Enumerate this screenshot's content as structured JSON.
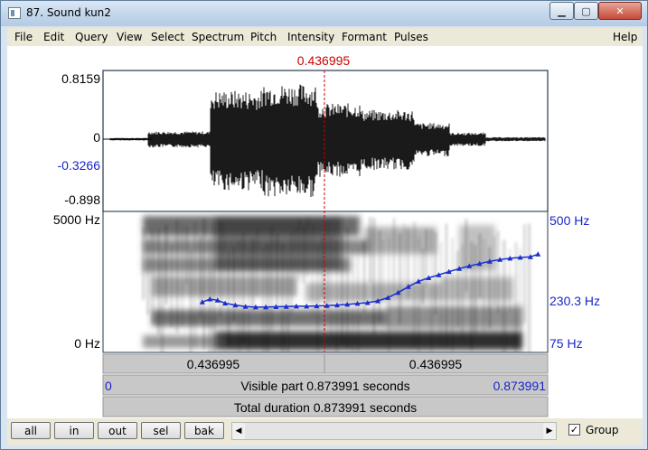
{
  "window": {
    "title": "87. Sound kun2",
    "minimize_label": "▁",
    "maximize_label": "▢",
    "close_label": "✕"
  },
  "menu": [
    "File",
    "Edit",
    "Query",
    "View",
    "Select",
    "Spectrum",
    "Pitch",
    "Intensity",
    "Formant",
    "Pulses",
    "Help"
  ],
  "cursor_time": "0.436995",
  "waveform": {
    "y_max": "0.8159",
    "y_zero": "0",
    "y_cursor_value": "-0.3266",
    "y_min": "-0.898"
  },
  "spectrogram": {
    "freq_max": "5000 Hz",
    "freq_min": "0 Hz",
    "pitch_max": "500 Hz",
    "pitch_at_cursor": "230.3 Hz",
    "pitch_min": "75 Hz"
  },
  "time_bars": {
    "left_segment": "0.436995",
    "right_segment": "0.436995",
    "visible_start": "0",
    "visible_label": "Visible part 0.873991 seconds",
    "visible_end": "0.873991",
    "total_label": "Total duration 0.873991 seconds"
  },
  "pitch_contour": {
    "x_seconds": [
      0.195,
      0.21,
      0.225,
      0.24,
      0.26,
      0.28,
      0.3,
      0.32,
      0.34,
      0.36,
      0.38,
      0.4,
      0.42,
      0.44,
      0.46,
      0.48,
      0.5,
      0.52,
      0.54,
      0.56,
      0.58,
      0.6,
      0.62,
      0.64,
      0.66,
      0.68,
      0.7,
      0.72,
      0.74,
      0.76,
      0.78,
      0.8,
      0.82,
      0.84,
      0.855
    ],
    "y_hz": [
      230,
      240,
      236,
      226,
      220,
      215,
      213,
      213,
      214,
      215,
      216,
      216,
      217,
      218,
      220,
      222,
      225,
      228,
      234,
      245,
      262,
      282,
      300,
      312,
      322,
      333,
      343,
      352,
      360,
      368,
      374,
      378,
      381,
      383,
      392
    ],
    "pitch_range_hz": [
      75,
      500
    ]
  },
  "buttons": {
    "all": "all",
    "in": "in",
    "out": "out",
    "sel": "sel",
    "bak": "bak",
    "group_label": "Group",
    "group_checked": "✓"
  },
  "colors": {
    "cursor": "#cc0000",
    "pitch": "#1a2fd0",
    "axis_blue": "#1a24c8",
    "frame": "#26384d"
  }
}
